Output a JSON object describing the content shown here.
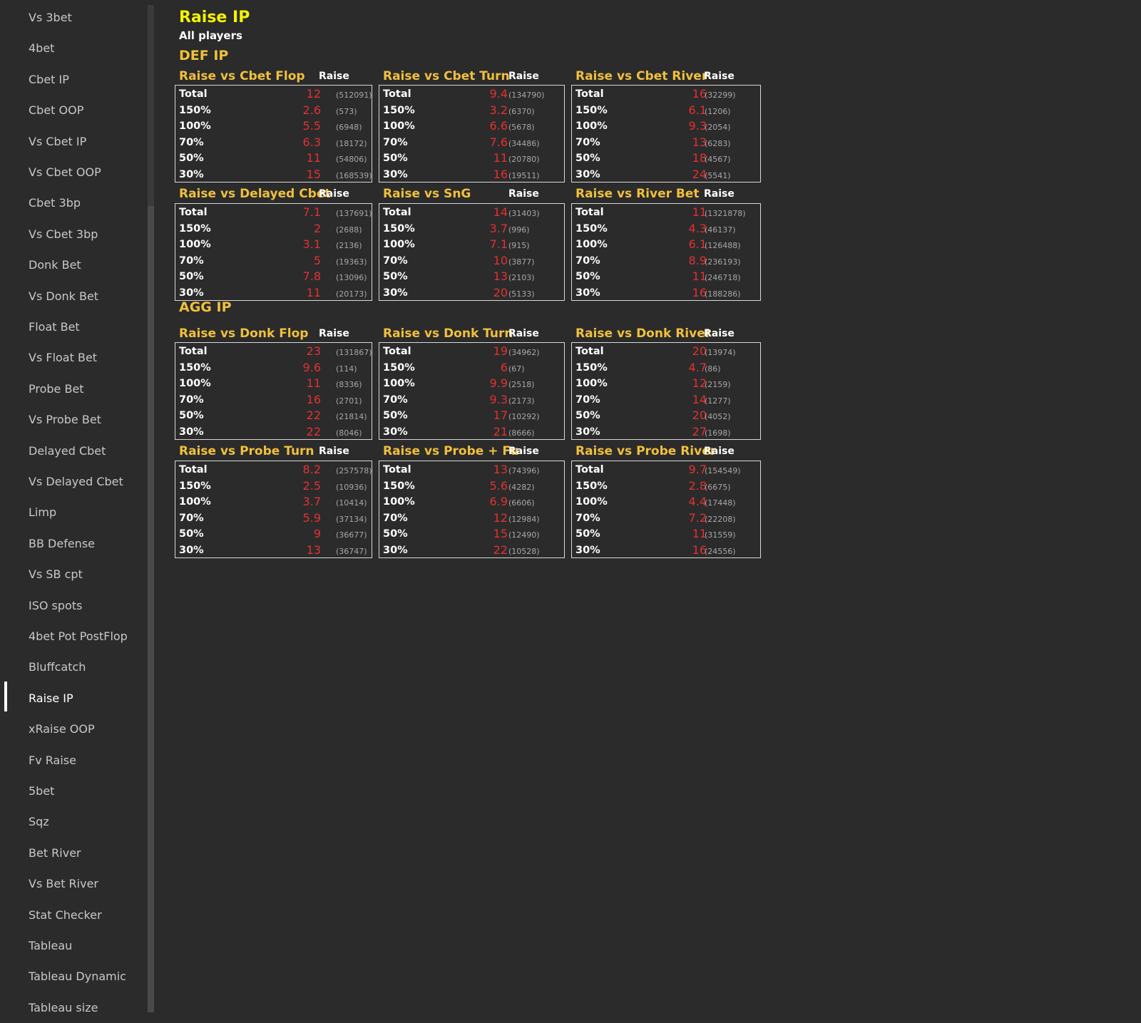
{
  "sidebar": {
    "active_index": 22,
    "items": [
      "Vs 3bet",
      "4bet",
      "Cbet IP",
      "Cbet OOP",
      "Vs Cbet IP",
      "Vs Cbet OOP",
      "Cbet 3bp",
      "Vs Cbet 3bp",
      "Donk Bet",
      "Vs Donk Bet",
      "Float Bet",
      "Vs Float Bet",
      "Probe Bet",
      "Vs Probe Bet",
      "Delayed Cbet",
      "Vs Delayed Cbet",
      "Limp",
      "BB Defense",
      "Vs SB cpt",
      "ISO spots",
      "4bet Pot PostFlop",
      "Bluffcatch",
      "Raise IP",
      "xRaise OOP",
      "Fv Raise",
      "5bet",
      "Sqz",
      "Bet River",
      "Vs Bet River",
      "Stat Checker",
      "Tableau",
      "Tableau Dynamic",
      "Tableau size"
    ]
  },
  "page": {
    "title": "Raise IP",
    "subtitle": "All players"
  },
  "colors": {
    "title": "#f4f400",
    "section": "#f0c03c",
    "value": "#e53030",
    "count": "#a8a8a8"
  },
  "sections": [
    {
      "title": "DEF IP",
      "stats": [
        {
          "title": "Raise vs Cbet Flop",
          "column": "Raise",
          "rows": [
            [
              "Total",
              "12",
              "(512091)"
            ],
            [
              "150%",
              "2.6",
              "(573)"
            ],
            [
              "100%",
              "5.5",
              "(6948)"
            ],
            [
              "70%",
              "6.3",
              "(18172)"
            ],
            [
              "50%",
              "11",
              "(54806)"
            ],
            [
              "30%",
              "15",
              "(168539)"
            ]
          ]
        },
        {
          "title": "Raise vs Cbet Turn",
          "column": "Raise",
          "rows": [
            [
              "Total",
              "9.4",
              "(134790)"
            ],
            [
              "150%",
              "3.2",
              "(6370)"
            ],
            [
              "100%",
              "6.6",
              "(5678)"
            ],
            [
              "70%",
              "7.6",
              "(34486)"
            ],
            [
              "50%",
              "11",
              "(20780)"
            ],
            [
              "30%",
              "16",
              "(19511)"
            ]
          ]
        },
        {
          "title": "Raise vs Cbet River",
          "column": "Raise",
          "rows": [
            [
              "Total",
              "16",
              "(32299)"
            ],
            [
              "150%",
              "6.1",
              "(1206)"
            ],
            [
              "100%",
              "9.3",
              "(2054)"
            ],
            [
              "70%",
              "13",
              "(6283)"
            ],
            [
              "50%",
              "18",
              "(4567)"
            ],
            [
              "30%",
              "24",
              "(5541)"
            ]
          ]
        },
        {
          "title": "Raise vs Delayed Cbet",
          "column": "Raise",
          "rows": [
            [
              "Total",
              "7.1",
              "(137691)"
            ],
            [
              "150%",
              "2",
              "(2688)"
            ],
            [
              "100%",
              "3.1",
              "(2136)"
            ],
            [
              "70%",
              "5",
              "(19363)"
            ],
            [
              "50%",
              "7.8",
              "(13096)"
            ],
            [
              "30%",
              "11",
              "(20173)"
            ]
          ]
        },
        {
          "title": "Raise vs SnG",
          "column": "Raise",
          "rows": [
            [
              "Total",
              "14",
              "(31403)"
            ],
            [
              "150%",
              "3.7",
              "(996)"
            ],
            [
              "100%",
              "7.1",
              "(915)"
            ],
            [
              "70%",
              "10",
              "(3877)"
            ],
            [
              "50%",
              "13",
              "(2103)"
            ],
            [
              "30%",
              "20",
              "(5133)"
            ]
          ]
        },
        {
          "title": "Raise vs River Bet",
          "column": "Raise",
          "rows": [
            [
              "Total",
              "11",
              "(1321878)"
            ],
            [
              "150%",
              "4.3",
              "(46137)"
            ],
            [
              "100%",
              "6.1",
              "(126488)"
            ],
            [
              "70%",
              "8.9",
              "(236193)"
            ],
            [
              "50%",
              "11",
              "(246718)"
            ],
            [
              "30%",
              "16",
              "(188286)"
            ]
          ]
        }
      ]
    },
    {
      "title": "AGG IP",
      "stats": [
        {
          "title": "Raise vs Donk Flop",
          "column": "Raise",
          "rows": [
            [
              "Total",
              "23",
              "(131867)"
            ],
            [
              "150%",
              "9.6",
              "(114)"
            ],
            [
              "100%",
              "11",
              "(8336)"
            ],
            [
              "70%",
              "16",
              "(2701)"
            ],
            [
              "50%",
              "22",
              "(21814)"
            ],
            [
              "30%",
              "22",
              "(8046)"
            ]
          ]
        },
        {
          "title": "Raise vs Donk Turn",
          "column": "Raise",
          "rows": [
            [
              "Total",
              "19",
              "(34962)"
            ],
            [
              "150%",
              "6",
              "(67)"
            ],
            [
              "100%",
              "9.9",
              "(2518)"
            ],
            [
              "70%",
              "9.3",
              "(2173)"
            ],
            [
              "50%",
              "17",
              "(10292)"
            ],
            [
              "30%",
              "21",
              "(8666)"
            ]
          ]
        },
        {
          "title": "Raise vs Donk River",
          "column": "Raise",
          "rows": [
            [
              "Total",
              "20",
              "(13974)"
            ],
            [
              "150%",
              "4.7",
              "(86)"
            ],
            [
              "100%",
              "12",
              "(2159)"
            ],
            [
              "70%",
              "14",
              "(1277)"
            ],
            [
              "50%",
              "20",
              "(4052)"
            ],
            [
              "30%",
              "27",
              "(1698)"
            ]
          ]
        },
        {
          "title": "Raise vs Probe Turn",
          "column": "Raise",
          "rows": [
            [
              "Total",
              "8.2",
              "(257578)"
            ],
            [
              "150%",
              "2.5",
              "(10936)"
            ],
            [
              "100%",
              "3.7",
              "(10414)"
            ],
            [
              "70%",
              "5.9",
              "(37134)"
            ],
            [
              "50%",
              "9",
              "(36677)"
            ],
            [
              "30%",
              "13",
              "(36747)"
            ]
          ]
        },
        {
          "title": "Raise vs Probe + Fu",
          "column": "Raise",
          "rows": [
            [
              "Total",
              "13",
              "(74396)"
            ],
            [
              "150%",
              "5.6",
              "(4282)"
            ],
            [
              "100%",
              "6.9",
              "(6606)"
            ],
            [
              "70%",
              "12",
              "(12984)"
            ],
            [
              "50%",
              "15",
              "(12490)"
            ],
            [
              "30%",
              "22",
              "(10528)"
            ]
          ]
        },
        {
          "title": "Raise vs Probe River",
          "column": "Raise",
          "rows": [
            [
              "Total",
              "9.7",
              "(154549)"
            ],
            [
              "150%",
              "2.8",
              "(6675)"
            ],
            [
              "100%",
              "4.4",
              "(17448)"
            ],
            [
              "70%",
              "7.2",
              "(22208)"
            ],
            [
              "50%",
              "11",
              "(31559)"
            ],
            [
              "30%",
              "16",
              "(24556)"
            ]
          ]
        }
      ]
    }
  ]
}
